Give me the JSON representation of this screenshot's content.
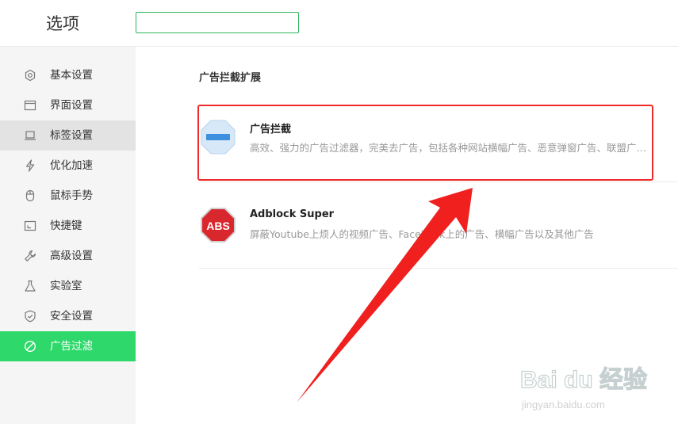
{
  "header": {
    "title": "选项",
    "search_value": ""
  },
  "sidebar": {
    "items": [
      {
        "label": "基本设置",
        "icon": "gear-icon",
        "state": "normal"
      },
      {
        "label": "界面设置",
        "icon": "window-icon",
        "state": "normal"
      },
      {
        "label": "标签设置",
        "icon": "tab-icon",
        "state": "hover"
      },
      {
        "label": "优化加速",
        "icon": "lightning-icon",
        "state": "normal"
      },
      {
        "label": "鼠标手势",
        "icon": "mouse-icon",
        "state": "normal"
      },
      {
        "label": "快捷键",
        "icon": "shortcut-icon",
        "state": "normal"
      },
      {
        "label": "高级设置",
        "icon": "wrench-icon",
        "state": "normal"
      },
      {
        "label": "实验室",
        "icon": "flask-icon",
        "state": "normal"
      },
      {
        "label": "安全设置",
        "icon": "shield-icon",
        "state": "normal"
      },
      {
        "label": "广告过滤",
        "icon": "block-icon",
        "state": "active"
      }
    ]
  },
  "main": {
    "section_title": "广告拦截扩展",
    "extensions": [
      {
        "name": "广告拦截",
        "description": "高效、强力的广告过滤器，完美去广告，包括各种网站横幅广告、恶意弹窗广告、联盟广告、视频广告等",
        "icon": "adblock-octagon-icon",
        "icon_color": "#cfe3f7"
      },
      {
        "name": "Adblock Super",
        "description": "屏蔽Youtube上烦人的视频广告、Facebook上的广告、横幅广告以及其他广告",
        "icon": "abs-stop-sign-icon",
        "icon_color": "#d9272e",
        "icon_text": "ABS"
      }
    ]
  },
  "annotation": {
    "highlight_color": "#f02a2a"
  },
  "watermark": {
    "brand": "Bai du 经验",
    "url": "jingyan.baidu.com"
  }
}
